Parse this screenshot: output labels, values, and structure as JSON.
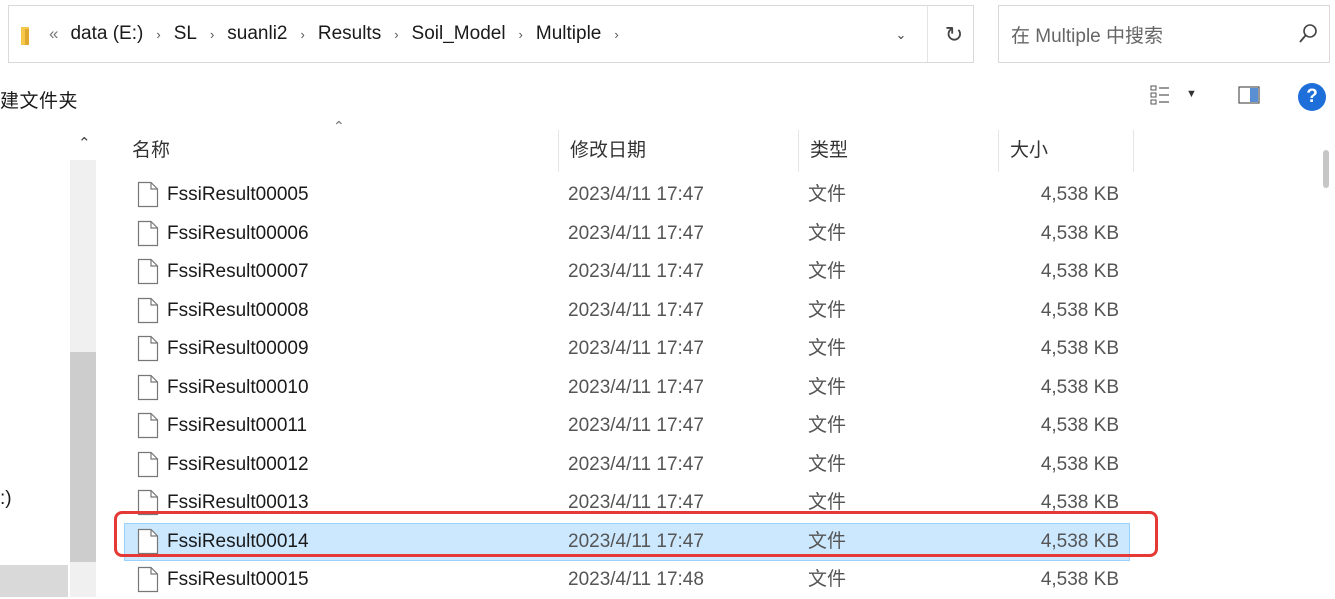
{
  "address_bar": {
    "overflow": "«",
    "crumbs": [
      "data (E:)",
      "SL",
      "suanli2",
      "Results",
      "Soil_Model",
      "Multiple"
    ],
    "separator": "›"
  },
  "search": {
    "placeholder": "在 Multiple 中搜索"
  },
  "toolbar": {
    "new_folder_label": "建文件夹"
  },
  "nav": {
    "drive_label": ":)"
  },
  "columns": {
    "name": "名称",
    "date": "修改日期",
    "type": "类型",
    "size": "大小"
  },
  "files": [
    {
      "name": "FssiResult00005",
      "date": "2023/4/11 17:47",
      "type": "文件",
      "size": "4,538 KB",
      "selected": false
    },
    {
      "name": "FssiResult00006",
      "date": "2023/4/11 17:47",
      "type": "文件",
      "size": "4,538 KB",
      "selected": false
    },
    {
      "name": "FssiResult00007",
      "date": "2023/4/11 17:47",
      "type": "文件",
      "size": "4,538 KB",
      "selected": false
    },
    {
      "name": "FssiResult00008",
      "date": "2023/4/11 17:47",
      "type": "文件",
      "size": "4,538 KB",
      "selected": false
    },
    {
      "name": "FssiResult00009",
      "date": "2023/4/11 17:47",
      "type": "文件",
      "size": "4,538 KB",
      "selected": false
    },
    {
      "name": "FssiResult00010",
      "date": "2023/4/11 17:47",
      "type": "文件",
      "size": "4,538 KB",
      "selected": false
    },
    {
      "name": "FssiResult00011",
      "date": "2023/4/11 17:47",
      "type": "文件",
      "size": "4,538 KB",
      "selected": false
    },
    {
      "name": "FssiResult00012",
      "date": "2023/4/11 17:47",
      "type": "文件",
      "size": "4,538 KB",
      "selected": false
    },
    {
      "name": "FssiResult00013",
      "date": "2023/4/11 17:47",
      "type": "文件",
      "size": "4,538 KB",
      "selected": false
    },
    {
      "name": "FssiResult00014",
      "date": "2023/4/11 17:47",
      "type": "文件",
      "size": "4,538 KB",
      "selected": true
    },
    {
      "name": "FssiResult00015",
      "date": "2023/4/11 17:48",
      "type": "文件",
      "size": "4,538 KB",
      "selected": false
    }
  ],
  "colors": {
    "selection": "#cce8ff",
    "callout": "#e53935",
    "folder": "#f5c84b",
    "help": "#1e6fd9"
  },
  "icons": {
    "address": "folder-icon",
    "dropdown": "chevron-down-icon",
    "refresh": "refresh-icon",
    "search": "search-icon",
    "view": "view-options-icon",
    "pane": "preview-pane-icon",
    "help": "help-icon",
    "file": "file-icon"
  }
}
